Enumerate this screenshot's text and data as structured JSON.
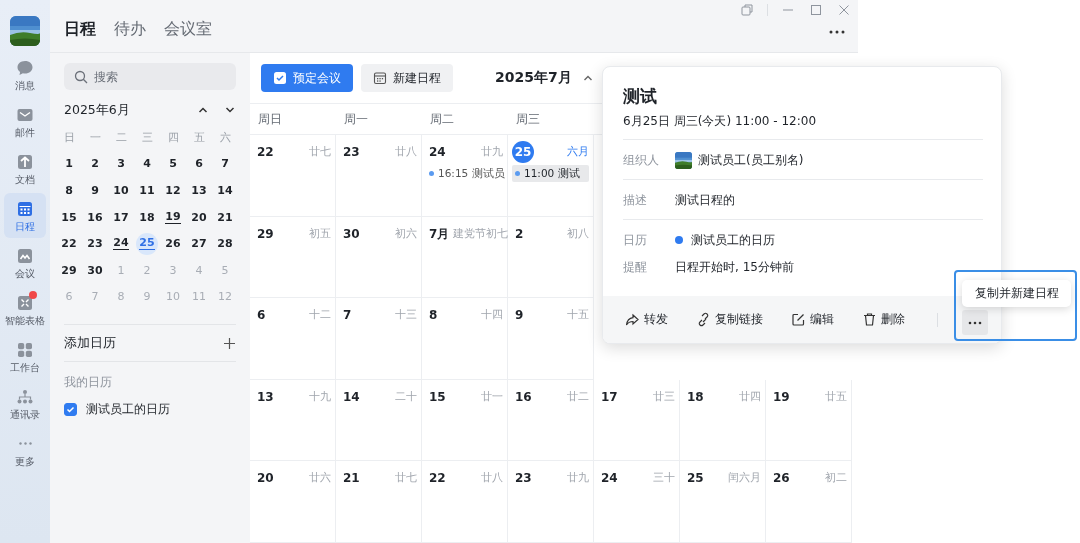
{
  "rail": {
    "items": [
      {
        "label": "消息",
        "kind": "chat",
        "selected": false,
        "badge": false
      },
      {
        "label": "邮件",
        "kind": "mail",
        "selected": false,
        "badge": false
      },
      {
        "label": "文档",
        "kind": "doc",
        "selected": false,
        "badge": false
      },
      {
        "label": "日程",
        "kind": "calendar",
        "selected": true,
        "badge": false
      },
      {
        "label": "会议",
        "kind": "meeting",
        "selected": false,
        "badge": false
      },
      {
        "label": "智能表格",
        "kind": "table",
        "selected": false,
        "badge": true
      },
      {
        "label": "工作台",
        "kind": "apps",
        "selected": false,
        "badge": false
      },
      {
        "label": "通讯录",
        "kind": "org",
        "selected": false,
        "badge": false
      },
      {
        "label": "更多",
        "kind": "more",
        "selected": false,
        "badge": false
      }
    ]
  },
  "tabs": [
    {
      "label": "日程",
      "selected": true
    },
    {
      "label": "待办",
      "selected": false
    },
    {
      "label": "会议室",
      "selected": false
    }
  ],
  "sidebar": {
    "search": {
      "placeholder": "搜索"
    },
    "mini_calendar": {
      "title": "2025年6月",
      "weekdays": [
        "日",
        "一",
        "二",
        "三",
        "四",
        "五",
        "六"
      ],
      "days": [
        {
          "label": "1",
          "muted": false,
          "marked": false,
          "selected": false
        },
        {
          "label": "2",
          "muted": false,
          "marked": false,
          "selected": false
        },
        {
          "label": "3",
          "muted": false,
          "marked": false,
          "selected": false
        },
        {
          "label": "4",
          "muted": false,
          "marked": false,
          "selected": false
        },
        {
          "label": "5",
          "muted": false,
          "marked": false,
          "selected": false
        },
        {
          "label": "6",
          "muted": false,
          "marked": false,
          "selected": false
        },
        {
          "label": "7",
          "muted": false,
          "marked": false,
          "selected": false
        },
        {
          "label": "8",
          "muted": false,
          "marked": false,
          "selected": false
        },
        {
          "label": "9",
          "muted": false,
          "marked": false,
          "selected": false
        },
        {
          "label": "10",
          "muted": false,
          "marked": false,
          "selected": false
        },
        {
          "label": "11",
          "muted": false,
          "marked": false,
          "selected": false
        },
        {
          "label": "12",
          "muted": false,
          "marked": false,
          "selected": false
        },
        {
          "label": "13",
          "muted": false,
          "marked": false,
          "selected": false
        },
        {
          "label": "14",
          "muted": false,
          "marked": false,
          "selected": false
        },
        {
          "label": "15",
          "muted": false,
          "marked": false,
          "selected": false
        },
        {
          "label": "16",
          "muted": false,
          "marked": false,
          "selected": false
        },
        {
          "label": "17",
          "muted": false,
          "marked": false,
          "selected": false
        },
        {
          "label": "18",
          "muted": false,
          "marked": false,
          "selected": false
        },
        {
          "label": "19",
          "muted": false,
          "marked": true,
          "selected": false
        },
        {
          "label": "20",
          "muted": false,
          "marked": false,
          "selected": false
        },
        {
          "label": "21",
          "muted": false,
          "marked": false,
          "selected": false
        },
        {
          "label": "22",
          "muted": false,
          "marked": false,
          "selected": false
        },
        {
          "label": "23",
          "muted": false,
          "marked": false,
          "selected": false
        },
        {
          "label": "24",
          "muted": false,
          "marked": true,
          "selected": false
        },
        {
          "label": "25",
          "muted": false,
          "marked": true,
          "selected": true
        },
        {
          "label": "26",
          "muted": false,
          "marked": false,
          "selected": false
        },
        {
          "label": "27",
          "muted": false,
          "marked": false,
          "selected": false
        },
        {
          "label": "28",
          "muted": false,
          "marked": false,
          "selected": false
        },
        {
          "label": "29",
          "muted": false,
          "marked": false,
          "selected": false
        },
        {
          "label": "30",
          "muted": false,
          "marked": false,
          "selected": false
        },
        {
          "label": "1",
          "muted": true,
          "marked": false,
          "selected": false
        },
        {
          "label": "2",
          "muted": true,
          "marked": false,
          "selected": false
        },
        {
          "label": "3",
          "muted": true,
          "marked": false,
          "selected": false
        },
        {
          "label": "4",
          "muted": true,
          "marked": false,
          "selected": false
        },
        {
          "label": "5",
          "muted": true,
          "marked": false,
          "selected": false
        },
        {
          "label": "6",
          "muted": true,
          "marked": false,
          "selected": false
        },
        {
          "label": "7",
          "muted": true,
          "marked": false,
          "selected": false
        },
        {
          "label": "8",
          "muted": true,
          "marked": false,
          "selected": false
        },
        {
          "label": "9",
          "muted": true,
          "marked": false,
          "selected": false
        },
        {
          "label": "10",
          "muted": true,
          "marked": false,
          "selected": false
        },
        {
          "label": "11",
          "muted": true,
          "marked": false,
          "selected": false
        },
        {
          "label": "12",
          "muted": true,
          "marked": false,
          "selected": false
        }
      ]
    },
    "add_calendar": "添加日历",
    "my_calendars_heading": "我的日历",
    "calendars": [
      {
        "label": "测试员工的日历",
        "checked": true
      }
    ]
  },
  "toolbar": {
    "buttons": [
      {
        "label": "预定会议",
        "kind": "primary"
      },
      {
        "label": "新建日程",
        "kind": "secondary"
      }
    ],
    "month": "2025年7月"
  },
  "calendar": {
    "weekdays": [
      "周日",
      "周一",
      "周二",
      "周三"
    ],
    "weeks": [
      [
        {
          "day": "22",
          "lunar": "廿七"
        },
        {
          "day": "23",
          "lunar": "廿八"
        },
        {
          "day": "24",
          "lunar": "廿九",
          "events": [
            {
              "text": "16:15 测试员",
              "selected": false
            }
          ]
        },
        {
          "day": "25",
          "lunar": "六月",
          "today": true,
          "events": [
            {
              "text": "11:00 测试",
              "selected": true
            }
          ]
        }
      ],
      [
        {
          "day": "29",
          "lunar": "初五"
        },
        {
          "day": "30",
          "lunar": "初六"
        },
        {
          "day": "7月",
          "lunar": "建党节初七"
        },
        {
          "day": "2",
          "lunar": "初八"
        }
      ],
      [
        {
          "day": "6",
          "lunar": "十二"
        },
        {
          "day": "7",
          "lunar": "十三"
        },
        {
          "day": "8",
          "lunar": "十四"
        },
        {
          "day": "9",
          "lunar": "十五"
        }
      ],
      [
        {
          "day": "13",
          "lunar": "十九"
        },
        {
          "day": "14",
          "lunar": "二十"
        },
        {
          "day": "15",
          "lunar": "廿一"
        },
        {
          "day": "16",
          "lunar": "廿二"
        },
        {
          "day": "17",
          "lunar": "廿三"
        },
        {
          "day": "18",
          "lunar": "廿四"
        },
        {
          "day": "19",
          "lunar": "廿五"
        }
      ],
      [
        {
          "day": "20",
          "lunar": "廿六"
        },
        {
          "day": "21",
          "lunar": "廿七"
        },
        {
          "day": "22",
          "lunar": "廿八"
        },
        {
          "day": "23",
          "lunar": "廿九"
        },
        {
          "day": "24",
          "lunar": "三十"
        },
        {
          "day": "25",
          "lunar": "闰六月"
        },
        {
          "day": "26",
          "lunar": "初二"
        }
      ]
    ]
  },
  "popup": {
    "title": "测试",
    "when": "6月25日 周三(今天) 11:00 - 12:00",
    "sections": [
      [
        {
          "label": "组织人",
          "value": "测试员工(员工别名)",
          "kind": "person"
        }
      ],
      [
        {
          "label": "描述",
          "value": "测试日程的",
          "kind": "text"
        }
      ],
      [
        {
          "label": "日历",
          "value": "测试员工的日历",
          "kind": "calendar",
          "color": "#2f7bf0"
        },
        {
          "label": "提醒",
          "value": "日程开始时, 15分钟前",
          "kind": "text"
        }
      ]
    ],
    "actions": [
      {
        "label": "转发",
        "kind": "share"
      },
      {
        "label": "复制链接",
        "kind": "link"
      },
      {
        "label": "编辑",
        "kind": "edit"
      },
      {
        "label": "删除",
        "kind": "trash"
      }
    ],
    "more_button": {
      "highlighted": true
    },
    "more_menu": {
      "items": [
        {
          "label": "复制并新建日程"
        }
      ]
    }
  }
}
